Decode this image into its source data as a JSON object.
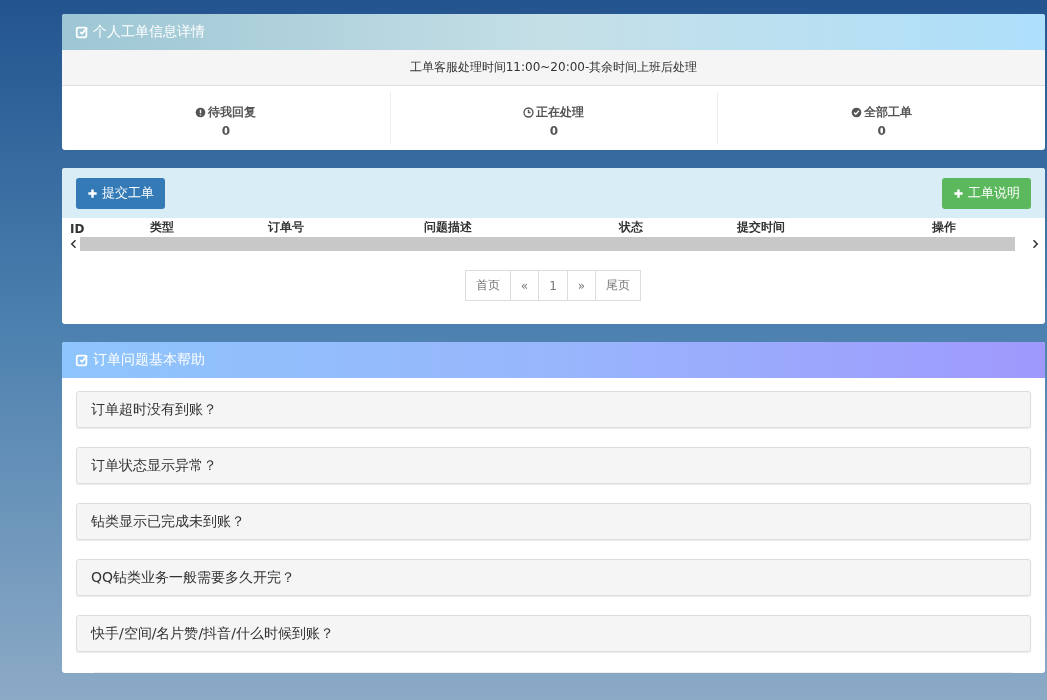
{
  "ticket_panel": {
    "title": "个人工单信息详情",
    "notice": "工单客服处理时间11:00~20:00-其余时间上班后处理",
    "stats": [
      {
        "kind": "pending",
        "label": "待我回复",
        "value": "0"
      },
      {
        "kind": "processing",
        "label": "正在处理",
        "value": "0"
      },
      {
        "kind": "all",
        "label": "全部工单",
        "value": "0"
      }
    ]
  },
  "list_panel": {
    "submit_button": "提交工单",
    "info_button": "工单说明",
    "table": {
      "columns": [
        "ID",
        "类型",
        "订单号",
        "问题描述",
        "状态",
        "提交时间",
        "操作"
      ]
    },
    "pagination": [
      {
        "label": "首页",
        "selected": false
      },
      {
        "label": "«",
        "selected": false
      },
      {
        "label": "1",
        "selected": false
      },
      {
        "label": "»",
        "selected": false
      },
      {
        "label": "尾页",
        "selected": false
      }
    ]
  },
  "help_panel": {
    "title": "订单问题基本帮助",
    "items": [
      {
        "question": "订单超时没有到账？",
        "expanded": false
      },
      {
        "question": "订单状态显示异常？",
        "expanded": false
      },
      {
        "question": "钻类显示已完成未到账？",
        "expanded": false
      },
      {
        "question": "QQ钻类业务一般需要多久开完？",
        "expanded": false
      },
      {
        "question": "快手/空间/名片赞/抖音/什么时候到账？",
        "expanded": false
      }
    ]
  }
}
